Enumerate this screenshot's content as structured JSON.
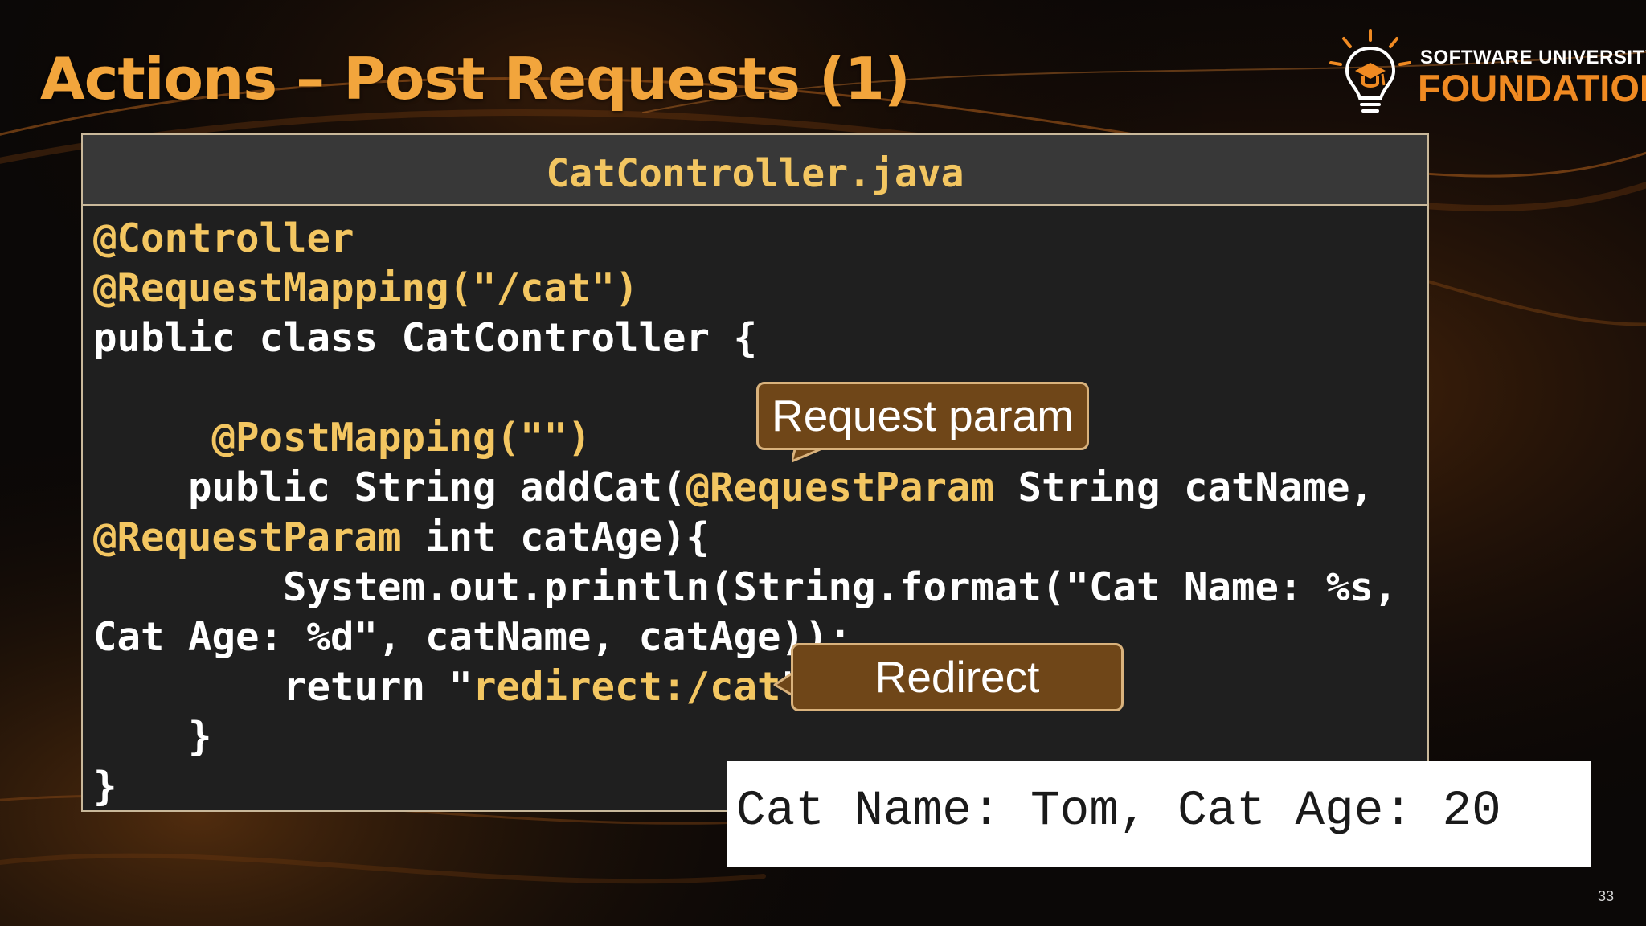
{
  "slide": {
    "title": "Actions – Post Requests (1)",
    "page_number": "33"
  },
  "logo": {
    "top_text": "SOFTWARE UNIVERSITY",
    "bottom_text": "FOUNDATION",
    "accent_color": "#f08a22"
  },
  "code_panel": {
    "filename": "CatController.java",
    "lines": [
      [
        {
          "t": "@Controller",
          "k": "ann"
        }
      ],
      [
        {
          "t": "@RequestMapping(\"/cat\")",
          "k": "ann"
        }
      ],
      [
        {
          "t": "public class CatController {",
          "k": "plain"
        }
      ],
      [
        {
          "t": "",
          "k": "plain"
        }
      ],
      [
        {
          "t": "     @PostMapping(\"\")",
          "k": "ann"
        }
      ],
      [
        {
          "t": "    public String addCat(",
          "k": "plain"
        },
        {
          "t": "@RequestParam",
          "k": "ann"
        },
        {
          "t": " String catName,",
          "k": "plain"
        }
      ],
      [
        {
          "t": "@RequestParam",
          "k": "ann"
        },
        {
          "t": " int catAge){",
          "k": "plain"
        }
      ],
      [
        {
          "t": "        System.out.println(String.format(\"Cat Name: %s,",
          "k": "plain"
        }
      ],
      [
        {
          "t": "Cat Age: %d\", catName, catAge));",
          "k": "plain"
        }
      ],
      [
        {
          "t": "        return \"",
          "k": "plain"
        },
        {
          "t": "redirect:/cat",
          "k": "str"
        },
        {
          "t": "\";",
          "k": "plain"
        }
      ],
      [
        {
          "t": "    }",
          "k": "plain"
        }
      ],
      [
        {
          "t": "}",
          "k": "plain"
        }
      ]
    ]
  },
  "callouts": {
    "request_param": "Request param",
    "redirect": "Redirect"
  },
  "output": {
    "text": "Cat Name: Tom, Cat Age: 20"
  },
  "colors": {
    "title": "#f2a53c",
    "code_highlight": "#f3c661",
    "callout_fill": "#6f4618",
    "callout_border": "#d9b27c"
  }
}
